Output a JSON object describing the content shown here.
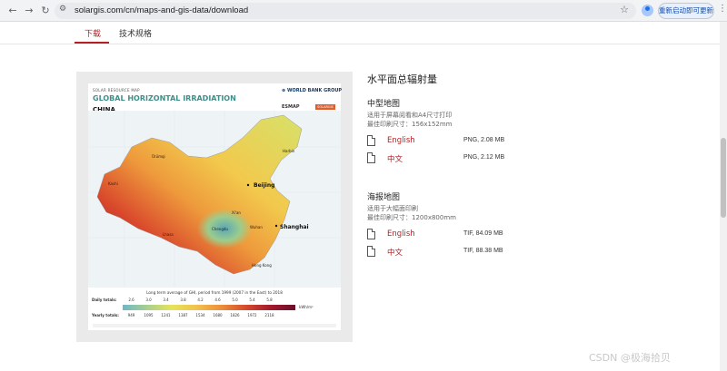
{
  "browser": {
    "url": "solargis.com/cn/maps-and-gis-data/download",
    "relaunch_label": "重新启动即可更新",
    "icons": [
      "back-icon",
      "forward-icon",
      "reload-icon",
      "site-info-icon",
      "star-icon",
      "profile-icon",
      "more-icon"
    ]
  },
  "tabs": [
    {
      "label": "下载",
      "active": true
    },
    {
      "label": "技术规格",
      "active": false
    }
  ],
  "map": {
    "subtitle": "SOLAR RESOURCE MAP",
    "title": "GLOBAL HORIZONTAL IRRADIATION",
    "country": "CHINA",
    "org1": "WORLD BANK GROUP",
    "org2": "ESMAP",
    "org3": "SOLARGIS",
    "cities": {
      "beijing": "Beijing",
      "shanghai": "Shanghai",
      "harbin": "Harbin",
      "hongkong": "Hong Kong",
      "chengdu": "Chengdu",
      "wuhan": "Wuhan",
      "xian": "Xi'an",
      "lhasa": "Lhasa",
      "urumqi": "Ürümqi",
      "kashi": "Kashi"
    },
    "legend": {
      "caption": "Long term average of GHI, period from 1999 (2007 in the East) to 2018",
      "daily_label": "Daily totals:",
      "daily_values": [
        "2.6",
        "3.0",
        "3.4",
        "3.8",
        "4.2",
        "4.6",
        "5.0",
        "5.4",
        "5.8"
      ],
      "yearly_label": "Yearly totals:",
      "yearly_values": [
        "949",
        "1095",
        "1241",
        "1387",
        "1534",
        "1680",
        "1826",
        "1972",
        "2118"
      ],
      "unit": "kWh/m²"
    }
  },
  "content": {
    "heading": "水平面总辐射量",
    "sections": [
      {
        "title": "中型地图",
        "desc1": "适用于屏幕阅看和A4尺寸打印",
        "desc2": "最佳印刷尺寸：156x152mm",
        "files": [
          {
            "lang": "English",
            "info": "PNG, 2.08 MB"
          },
          {
            "lang": "中文",
            "info": "PNG, 2.12 MB"
          }
        ]
      },
      {
        "title": "海报地图",
        "desc1": "适用于大幅面印刷",
        "desc2": "最佳印刷尺寸：1200x800mm",
        "files": [
          {
            "lang": "English",
            "info": "TIF, 84.09 MB"
          },
          {
            "lang": "中文",
            "info": "TIF, 88.38 MB"
          }
        ]
      }
    ]
  },
  "watermark": "CSDN @极海拾贝"
}
